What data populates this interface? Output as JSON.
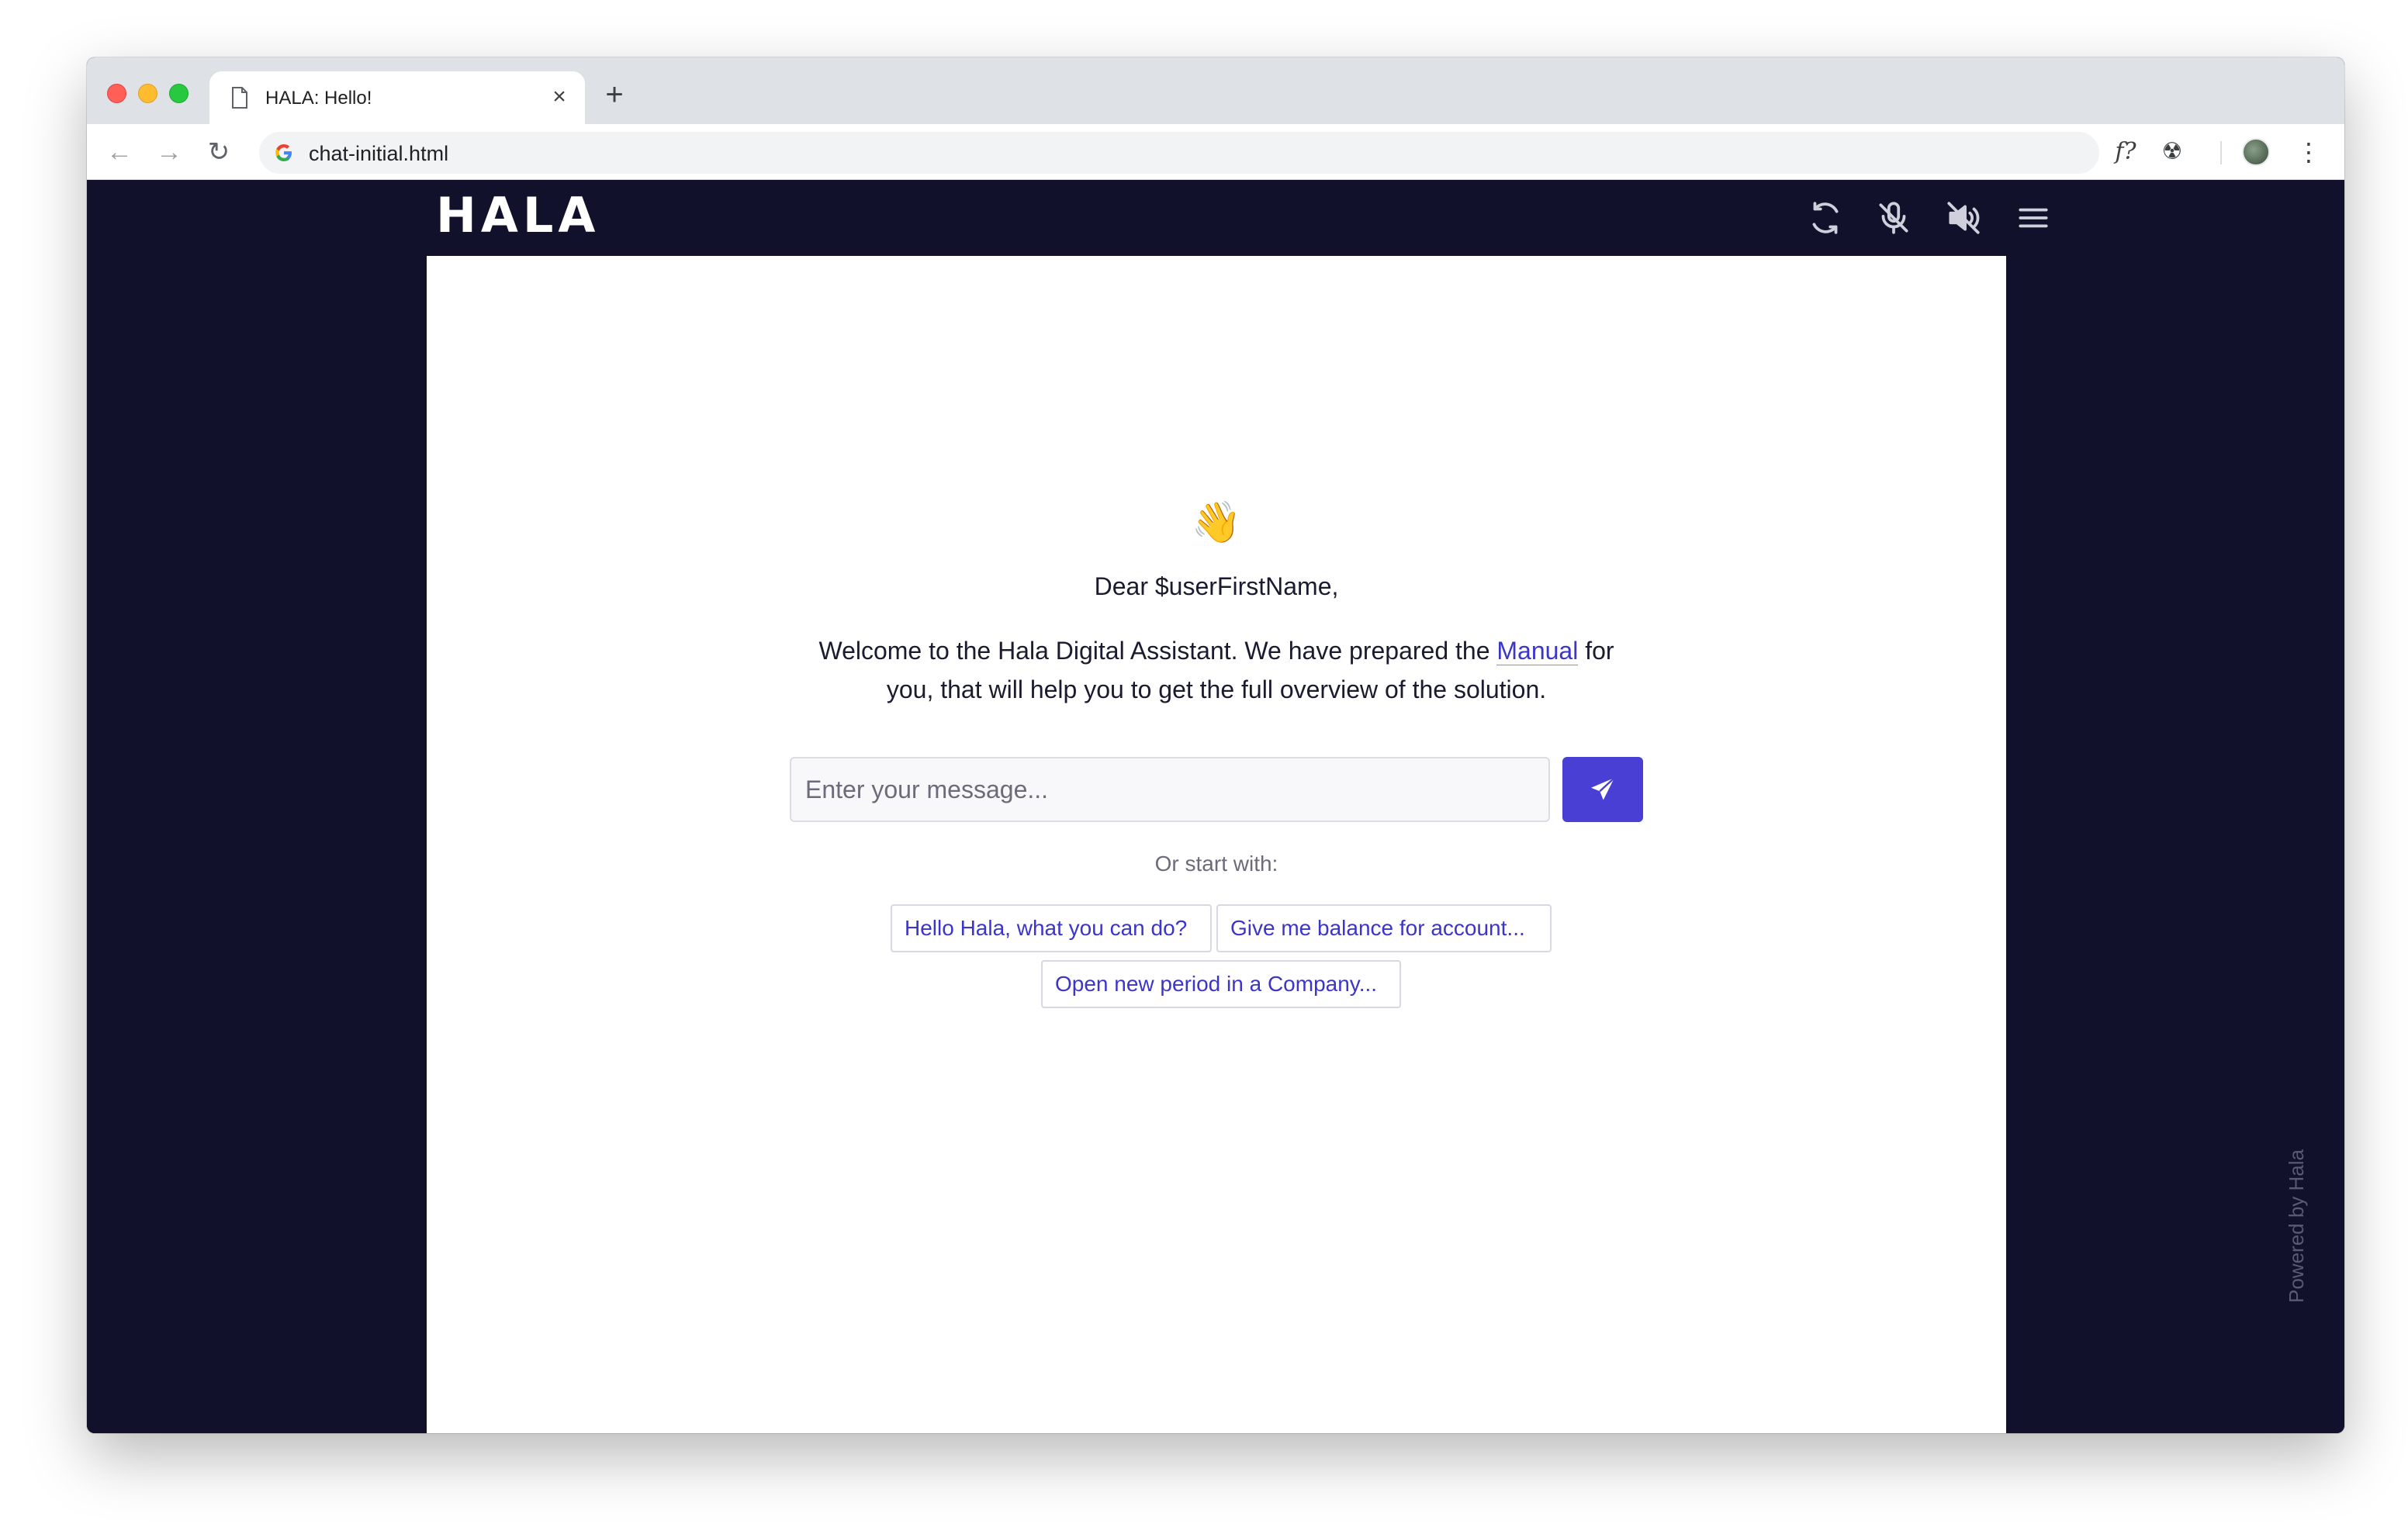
{
  "browser": {
    "tab_title": "HALA: Hello!",
    "tab_close": "×",
    "new_tab": "+",
    "url": "chat-initial.html",
    "back": "←",
    "forward": "→",
    "reload": "↻",
    "ext_formula": "f?",
    "ext_radiation": "☢",
    "menu": "⋮",
    "icons": [
      "document-icon",
      "google-icon",
      "formula-extension-icon",
      "radiation-extension-icon",
      "avatar",
      "kebab-menu-icon"
    ]
  },
  "app": {
    "logo": "HALA",
    "header_icons": [
      "sync-icon",
      "mic-off-icon",
      "volume-off-icon",
      "hamburger-menu-icon"
    ],
    "wave_emoji": "👋",
    "greeting": "Dear $userFirstName,",
    "intro_before_link": "Welcome to the Hala Digital Assistant. We have prepared the ",
    "intro_link": "Manual",
    "intro_after_link": " for you, that will help you to get the full overview of the solution.",
    "input_placeholder": "Enter your message...",
    "or_start_with": "Or start with:",
    "suggestions": [
      "Hello Hala, what you can do?",
      "Give me balance for account...",
      "Open new period in a Company..."
    ],
    "powered_by": "Powered by Hala",
    "colors": {
      "background": "#11112b",
      "accent": "#4a3fd4",
      "link": "#3b35c9"
    }
  }
}
